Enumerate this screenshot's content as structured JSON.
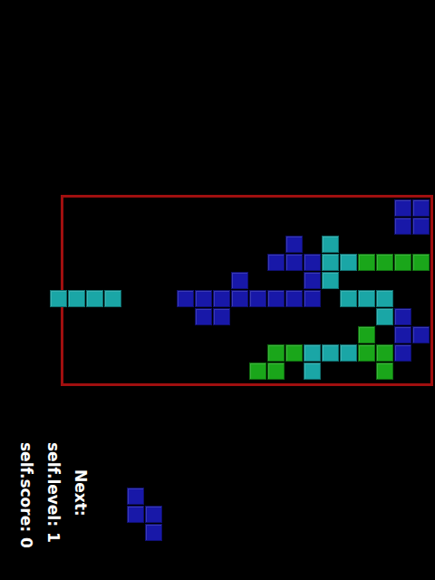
{
  "board": {
    "cells": [
      {
        "col": 18,
        "row": 0,
        "color": "#1818a8"
      },
      {
        "col": 19,
        "row": 0,
        "color": "#1818a8"
      },
      {
        "col": 18,
        "row": 1,
        "color": "#1818a8"
      },
      {
        "col": 19,
        "row": 1,
        "color": "#1818a8"
      },
      {
        "col": 12,
        "row": 2,
        "color": "#1818a8"
      },
      {
        "col": 14,
        "row": 2,
        "color": "#1aa6a6"
      },
      {
        "col": 11,
        "row": 3,
        "color": "#1818a8"
      },
      {
        "col": 12,
        "row": 3,
        "color": "#1818a8"
      },
      {
        "col": 13,
        "row": 3,
        "color": "#1818a8"
      },
      {
        "col": 14,
        "row": 3,
        "color": "#1aa6a6"
      },
      {
        "col": 15,
        "row": 3,
        "color": "#1aa6a6"
      },
      {
        "col": 16,
        "row": 3,
        "color": "#1aa61a"
      },
      {
        "col": 17,
        "row": 3,
        "color": "#1aa61a"
      },
      {
        "col": 18,
        "row": 3,
        "color": "#1aa61a"
      },
      {
        "col": 19,
        "row": 3,
        "color": "#1aa61a"
      },
      {
        "col": 9,
        "row": 4,
        "color": "#1818a8"
      },
      {
        "col": 13,
        "row": 4,
        "color": "#1818a8"
      },
      {
        "col": 14,
        "row": 4,
        "color": "#1aa6a6"
      },
      {
        "col": 6,
        "row": 5,
        "color": "#1818a8"
      },
      {
        "col": 7,
        "row": 5,
        "color": "#1818a8"
      },
      {
        "col": 8,
        "row": 5,
        "color": "#1818a8"
      },
      {
        "col": 9,
        "row": 5,
        "color": "#1818a8"
      },
      {
        "col": 10,
        "row": 5,
        "color": "#1818a8"
      },
      {
        "col": 11,
        "row": 5,
        "color": "#1818a8"
      },
      {
        "col": 12,
        "row": 5,
        "color": "#1818a8"
      },
      {
        "col": 13,
        "row": 5,
        "color": "#1818a8"
      },
      {
        "col": 15,
        "row": 5,
        "color": "#1aa6a6"
      },
      {
        "col": 16,
        "row": 5,
        "color": "#1aa6a6"
      },
      {
        "col": 17,
        "row": 5,
        "color": "#1aa6a6"
      },
      {
        "col": 7,
        "row": 6,
        "color": "#1818a8"
      },
      {
        "col": 8,
        "row": 6,
        "color": "#1818a8"
      },
      {
        "col": 17,
        "row": 6,
        "color": "#1aa6a6"
      },
      {
        "col": 18,
        "row": 6,
        "color": "#1818a8"
      },
      {
        "col": 16,
        "row": 7,
        "color": "#1aa61a"
      },
      {
        "col": 18,
        "row": 7,
        "color": "#1818a8"
      },
      {
        "col": 19,
        "row": 7,
        "color": "#1818a8"
      },
      {
        "col": 11,
        "row": 8,
        "color": "#1aa61a"
      },
      {
        "col": 12,
        "row": 8,
        "color": "#1aa61a"
      },
      {
        "col": 13,
        "row": 8,
        "color": "#1aa6a6"
      },
      {
        "col": 14,
        "row": 8,
        "color": "#1aa6a6"
      },
      {
        "col": 15,
        "row": 8,
        "color": "#1aa6a6"
      },
      {
        "col": 16,
        "row": 8,
        "color": "#1aa61a"
      },
      {
        "col": 17,
        "row": 8,
        "color": "#1aa61a"
      },
      {
        "col": 18,
        "row": 8,
        "color": "#1818a8"
      },
      {
        "col": 10,
        "row": 9,
        "color": "#1aa61a"
      },
      {
        "col": 11,
        "row": 9,
        "color": "#1aa61a"
      },
      {
        "col": 13,
        "row": 9,
        "color": "#1aa6a6"
      },
      {
        "col": 17,
        "row": 9,
        "color": "#1aa61a"
      }
    ]
  },
  "falling_piece": {
    "cells": [
      {
        "col": -1,
        "row": 5,
        "color": "#1aa6a6"
      },
      {
        "col": 0,
        "row": 5,
        "color": "#1aa6a6"
      },
      {
        "col": 1,
        "row": 5,
        "color": "#1aa6a6"
      },
      {
        "col": 2,
        "row": 5,
        "color": "#1aa6a6"
      }
    ]
  },
  "score": "self.score: 0",
  "level": "self.level: 1",
  "next": {
    "label": "Next:",
    "cells": [
      {
        "col": 0,
        "row": 0,
        "color": "#1818a8"
      },
      {
        "col": 0,
        "row": 1,
        "color": "#1818a8"
      },
      {
        "col": 1,
        "row": 1,
        "color": "#1818a8"
      },
      {
        "col": 1,
        "row": 2,
        "color": "#1818a8"
      }
    ]
  }
}
